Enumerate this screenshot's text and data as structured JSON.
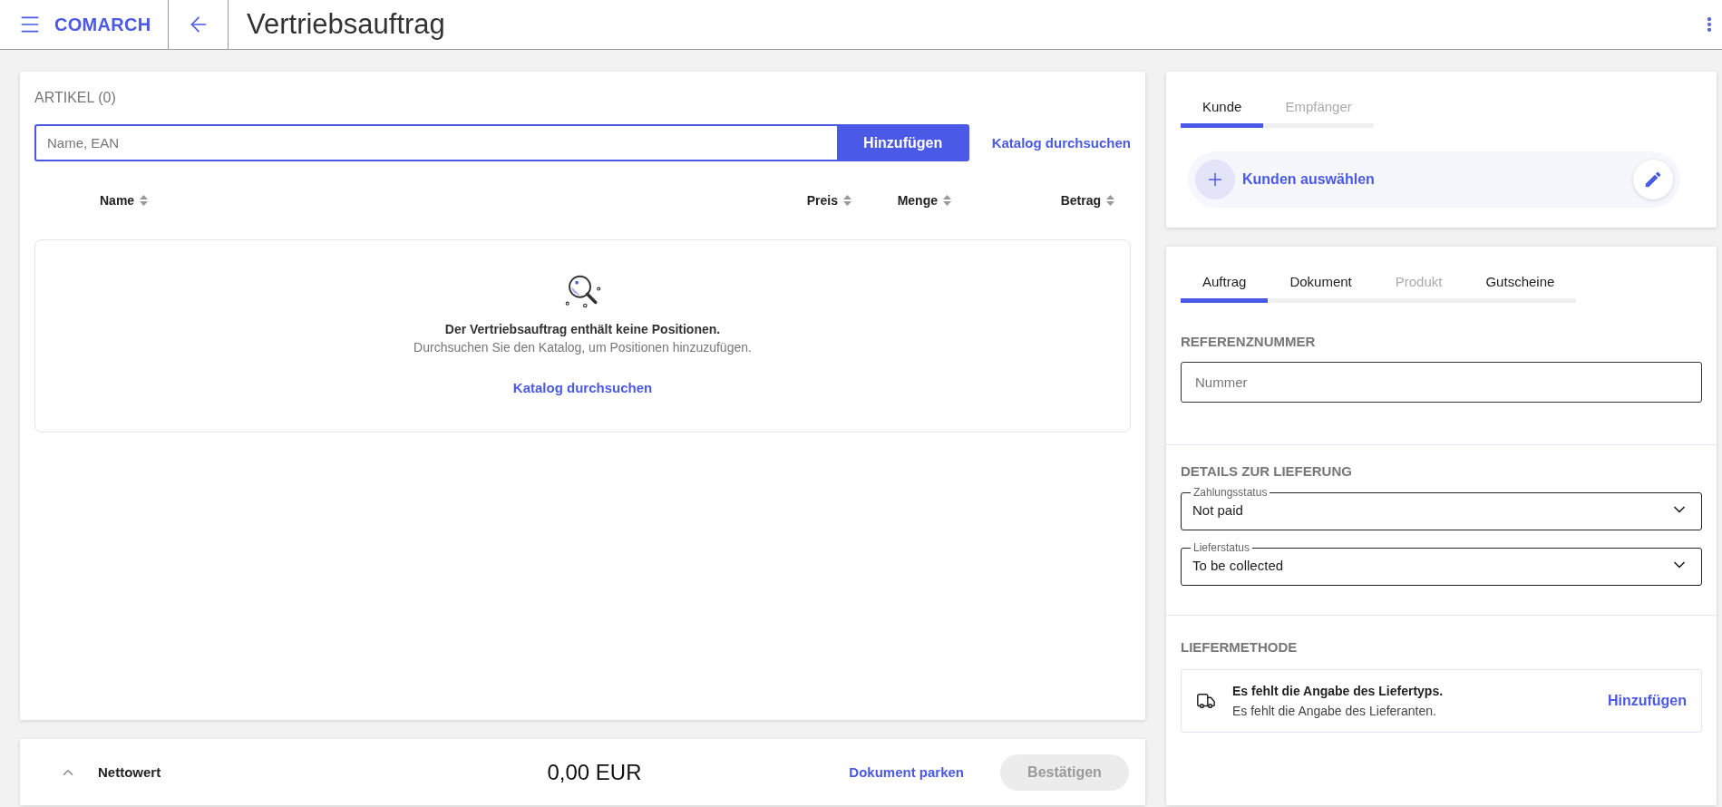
{
  "header": {
    "logo": "COMARCH",
    "title": "Vertriebsauftrag"
  },
  "articles": {
    "heading": "ARTIKEL (0)",
    "search": {
      "placeholder": "Name, EAN"
    },
    "add_button": "Hinzufügen",
    "catalog_link": "Katalog durchsuchen",
    "columns": [
      "Name",
      "Preis",
      "Menge",
      "Betrag"
    ],
    "empty": {
      "title": "Der Vertriebsauftrag enthält keine Positionen.",
      "hint": "Durchsuchen Sie den Katalog, um Positionen hinzuzufügen.",
      "link": "Katalog durchsuchen"
    }
  },
  "footer": {
    "label": "Nettowert",
    "amount": "0,00 EUR",
    "park": "Dokument parken",
    "confirm": {
      "label": "Bestätigen",
      "disabled": true
    }
  },
  "customer": {
    "tabs": [
      {
        "label": "Kunde",
        "selected": true,
        "disabled": false
      },
      {
        "label": "Empfänger",
        "selected": false,
        "disabled": true
      }
    ],
    "select": "Kunden auswählen"
  },
  "order": {
    "tabs": [
      {
        "label": "Auftrag",
        "selected": true,
        "disabled": false
      },
      {
        "label": "Dokument",
        "selected": false,
        "disabled": false
      },
      {
        "label": "Produkt",
        "selected": false,
        "disabled": true
      },
      {
        "label": "Gutscheine",
        "selected": false,
        "disabled": false
      }
    ],
    "reference": {
      "heading": "REFERENZNUMMER",
      "placeholder": "Nummer"
    },
    "delivery": {
      "heading": "DETAILS ZUR LIEFERUNG",
      "selects": [
        {
          "label": "Zahlungsstatus",
          "value": "Not paid"
        },
        {
          "label": "Lieferstatus",
          "value": "To be collected"
        }
      ]
    },
    "method": {
      "heading": "LIEFERMETHODE",
      "title": "Es fehlt die Angabe des Liefertyps.",
      "subtitle": "Es fehlt die Angabe des Lieferanten.",
      "action": "Hinzufügen"
    }
  }
}
